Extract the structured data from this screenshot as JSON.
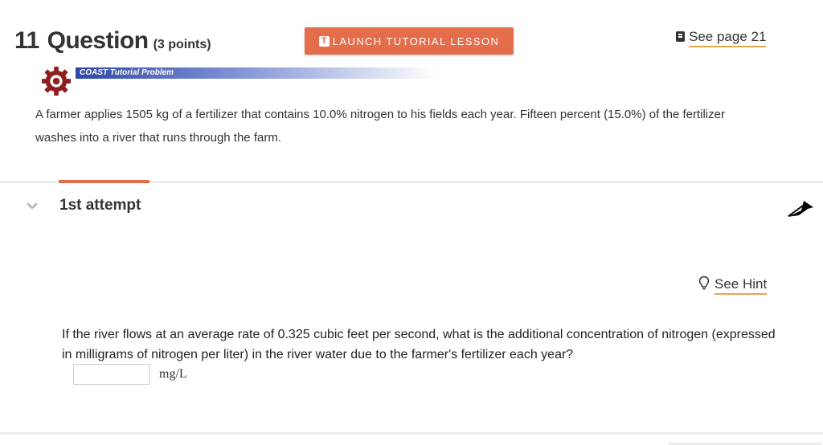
{
  "header": {
    "number": "11",
    "question_word": "Question",
    "points": "(3 points)",
    "launch_button_label": "LAUNCH TUTORIAL LESSON",
    "see_page_label": "See page 21"
  },
  "coast": {
    "banner_label": "COAST Tutorial Problem"
  },
  "prompt": {
    "text": "A farmer applies 1505 kg of a fertilizer that contains 10.0% nitrogen to his fields each year. Fifteen percent (15.0%) of the fertilizer washes into a river that runs through the farm."
  },
  "attempt": {
    "label": "1st attempt"
  },
  "hint": {
    "label": "See Hint"
  },
  "question": {
    "text": "If the river flows at an average rate of 0.325 cubic feet per second, what is the additional concentration of nitrogen (expressed in milligrams of nitrogen per liter) in the river water due to the farmer's fertilizer each year?",
    "answer_value": "",
    "unit": "mg/L"
  },
  "icons": {
    "gear": "gear-icon",
    "book": "book-icon",
    "tutorial": "tutorial-icon",
    "chevron": "chevron-down-icon",
    "lightbulb": "lightbulb-icon",
    "cursor": "cursor-arrow-icon"
  },
  "colors": {
    "accent": "#e46d4c",
    "link_underline": "#e0a94b",
    "banner_blue": "#2e47a6",
    "gear_red": "#8f1f1f"
  }
}
